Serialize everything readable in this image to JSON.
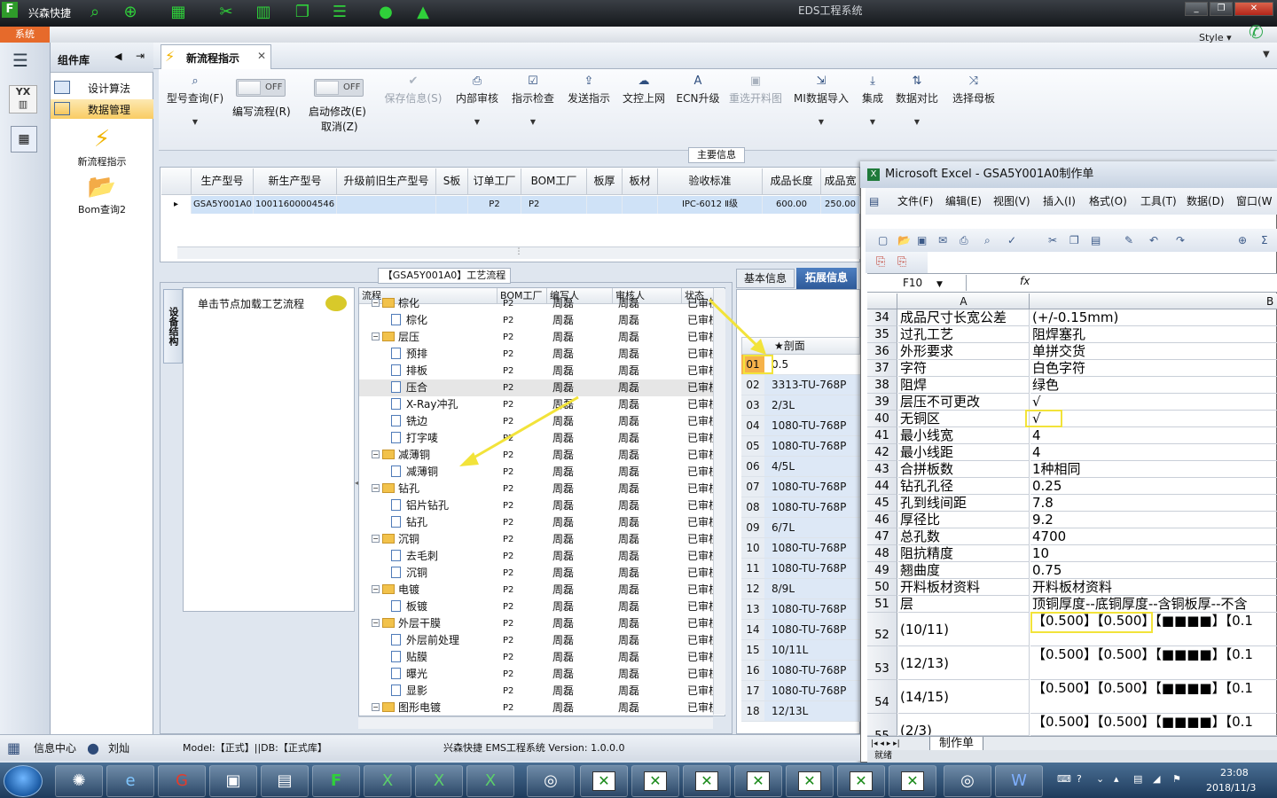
{
  "titlebar": {
    "app": "兴森快捷",
    "window_title": "EDS工程系统"
  },
  "topbar": {
    "system_tab": "系统",
    "style_menu": "Style"
  },
  "component_panel": {
    "title": "组件库",
    "items": [
      {
        "label": "设计算法"
      },
      {
        "label": "数据管理"
      }
    ],
    "big_items": [
      {
        "label": "新流程指示"
      },
      {
        "label": "Bom查询2"
      }
    ]
  },
  "doc_tab": {
    "label": "新流程指示"
  },
  "ribbon": {
    "model_query": "型号查询(F)",
    "toggle_off": "OFF",
    "edit_flow": "编写流程(R)",
    "enable_modify": "启动修改(E)",
    "cancel": "取消(Z)",
    "buttons": [
      {
        "label": "保存信息(S)",
        "disabled": true
      },
      {
        "label": "内部审核",
        "disabled": false
      },
      {
        "label": "指示检查",
        "disabled": false
      },
      {
        "label": "发送指示",
        "disabled": false
      },
      {
        "label": "文控上网",
        "disabled": false
      },
      {
        "label": "ECN升级",
        "disabled": false
      },
      {
        "label": "重选开料图",
        "disabled": true
      },
      {
        "label": "MI数据导入",
        "disabled": false
      },
      {
        "label": "集成",
        "disabled": false
      },
      {
        "label": "数据对比",
        "disabled": false
      },
      {
        "label": "选择母板",
        "disabled": false
      }
    ]
  },
  "main_info": {
    "group_label": "主要信息",
    "columns": [
      "生产型号",
      "新生产型号",
      "升级前旧生产型号",
      "S板",
      "订单工厂",
      "BOM工厂",
      "板厚",
      "板材",
      "验收标准",
      "成品长度",
      "成品宽"
    ],
    "row": [
      "GSA5Y001A0",
      "10011600004546",
      "",
      "",
      "P2",
      "P2",
      "",
      "",
      "IPC-6012 Ⅱ级",
      "600.00",
      "250.00"
    ]
  },
  "process": {
    "title": "【GSA5Y001A0】工艺流程",
    "side_tab": "设备结构",
    "load_hint": "单击节点加载工艺流程",
    "columns": [
      "流程",
      "BOM工厂",
      "编写人",
      "审核人",
      "状态"
    ],
    "rows": [
      {
        "name": "棕化",
        "level": 0,
        "kind": "folder",
        "bom": "P2",
        "writer": "周磊",
        "reviewer": "周磊",
        "status": "已审核"
      },
      {
        "name": "棕化",
        "level": 1,
        "kind": "page",
        "bom": "P2",
        "writer": "周磊",
        "reviewer": "周磊",
        "status": "已审核"
      },
      {
        "name": "层压",
        "level": 0,
        "kind": "folder",
        "bom": "P2",
        "writer": "周磊",
        "reviewer": "周磊",
        "status": "已审核"
      },
      {
        "name": "预排",
        "level": 1,
        "kind": "page",
        "bom": "P2",
        "writer": "周磊",
        "reviewer": "周磊",
        "status": "已审核"
      },
      {
        "name": "排板",
        "level": 1,
        "kind": "page",
        "bom": "P2",
        "writer": "周磊",
        "reviewer": "周磊",
        "status": "已审核"
      },
      {
        "name": "压合",
        "level": 1,
        "kind": "page",
        "bom": "P2",
        "writer": "周磊",
        "reviewer": "周磊",
        "status": "已审核"
      },
      {
        "name": "X-Ray冲孔",
        "level": 1,
        "kind": "page",
        "bom": "P2",
        "writer": "周磊",
        "reviewer": "周磊",
        "status": "已审核"
      },
      {
        "name": "铣边",
        "level": 1,
        "kind": "page",
        "bom": "P2",
        "writer": "周磊",
        "reviewer": "周磊",
        "status": "已审核"
      },
      {
        "name": "打字唛",
        "level": 1,
        "kind": "page",
        "bom": "P2",
        "writer": "周磊",
        "reviewer": "周磊",
        "status": "已审核"
      },
      {
        "name": "减薄铜",
        "level": 0,
        "kind": "folder",
        "bom": "P2",
        "writer": "周磊",
        "reviewer": "周磊",
        "status": "已审核"
      },
      {
        "name": "减薄铜",
        "level": 1,
        "kind": "page",
        "bom": "P2",
        "writer": "周磊",
        "reviewer": "周磊",
        "status": "已审核"
      },
      {
        "name": "钻孔",
        "level": 0,
        "kind": "folder",
        "bom": "P2",
        "writer": "周磊",
        "reviewer": "周磊",
        "status": "已审核"
      },
      {
        "name": "铝片钻孔",
        "level": 1,
        "kind": "page",
        "bom": "P2",
        "writer": "周磊",
        "reviewer": "周磊",
        "status": "已审核"
      },
      {
        "name": "钻孔",
        "level": 1,
        "kind": "page",
        "bom": "P2",
        "writer": "周磊",
        "reviewer": "周磊",
        "status": "已审核"
      },
      {
        "name": "沉铜",
        "level": 0,
        "kind": "folder",
        "bom": "P2",
        "writer": "周磊",
        "reviewer": "周磊",
        "status": "已审核"
      },
      {
        "name": "去毛刺",
        "level": 1,
        "kind": "page",
        "bom": "P2",
        "writer": "周磊",
        "reviewer": "周磊",
        "status": "已审核"
      },
      {
        "name": "沉铜",
        "level": 1,
        "kind": "page",
        "bom": "P2",
        "writer": "周磊",
        "reviewer": "周磊",
        "status": "已审核"
      },
      {
        "name": "电镀",
        "level": 0,
        "kind": "folder",
        "bom": "P2",
        "writer": "周磊",
        "reviewer": "周磊",
        "status": "已审核"
      },
      {
        "name": "板镀",
        "level": 1,
        "kind": "page",
        "bom": "P2",
        "writer": "周磊",
        "reviewer": "周磊",
        "status": "已审核"
      },
      {
        "name": "外层干膜",
        "level": 0,
        "kind": "folder",
        "bom": "P2",
        "writer": "周磊",
        "reviewer": "周磊",
        "status": "已审核"
      },
      {
        "name": "外层前处理",
        "level": 1,
        "kind": "page",
        "bom": "P2",
        "writer": "周磊",
        "reviewer": "周磊",
        "status": "已审核"
      },
      {
        "name": "贴膜",
        "level": 1,
        "kind": "page",
        "bom": "P2",
        "writer": "周磊",
        "reviewer": "周磊",
        "status": "已审核"
      },
      {
        "name": "曝光",
        "level": 1,
        "kind": "page",
        "bom": "P2",
        "writer": "周磊",
        "reviewer": "周磊",
        "status": "已审核"
      },
      {
        "name": "显影",
        "level": 1,
        "kind": "page",
        "bom": "P2",
        "writer": "周磊",
        "reviewer": "周磊",
        "status": "已审核"
      },
      {
        "name": "图形电镀",
        "level": 0,
        "kind": "folder",
        "bom": "P2",
        "writer": "周磊",
        "reviewer": "周磊",
        "status": "已审核"
      }
    ]
  },
  "side_panel": {
    "tabs": [
      "基本信息",
      "拓展信息"
    ],
    "col_header": "★剖面",
    "rows": [
      [
        "01",
        "0.5"
      ],
      [
        "02",
        "3313-TU-768P"
      ],
      [
        "03",
        "2/3L"
      ],
      [
        "04",
        "1080-TU-768P"
      ],
      [
        "05",
        "1080-TU-768P"
      ],
      [
        "06",
        "4/5L"
      ],
      [
        "07",
        "1080-TU-768P"
      ],
      [
        "08",
        "1080-TU-768P"
      ],
      [
        "09",
        "6/7L"
      ],
      [
        "10",
        "1080-TU-768P"
      ],
      [
        "11",
        "1080-TU-768P"
      ],
      [
        "12",
        "8/9L"
      ],
      [
        "13",
        "1080-TU-768P"
      ],
      [
        "14",
        "1080-TU-768P"
      ],
      [
        "15",
        "10/11L"
      ],
      [
        "16",
        "1080-TU-768P"
      ],
      [
        "17",
        "1080-TU-768P"
      ],
      [
        "18",
        "12/13L"
      ]
    ]
  },
  "excel": {
    "title": "Microsoft Excel - GSA5Y001A0制作单",
    "menu": [
      "文件(F)",
      "编辑(E)",
      "视图(V)",
      "插入(I)",
      "格式(O)",
      "工具(T)",
      "数据(D)",
      "窗口(W"
    ],
    "namebox": "F10",
    "fx": "fx",
    "col_a": "A",
    "col_b": "B",
    "rows": [
      {
        "n": "34",
        "a": "成品尺寸长宽公差",
        "b": "(+/-0.15mm)"
      },
      {
        "n": "35",
        "a": "过孔工艺",
        "b": "阻焊塞孔"
      },
      {
        "n": "36",
        "a": "外形要求",
        "b": "单拼交货"
      },
      {
        "n": "37",
        "a": "字符",
        "b": "白色字符"
      },
      {
        "n": "38",
        "a": "阻焊",
        "b": "绿色"
      },
      {
        "n": "39",
        "a": "层压不可更改",
        "b": "√"
      },
      {
        "n": "40",
        "a": "无铜区",
        "b": "√"
      },
      {
        "n": "41",
        "a": "最小线宽",
        "b": "4"
      },
      {
        "n": "42",
        "a": "最小线距",
        "b": "4"
      },
      {
        "n": "43",
        "a": "合拼板数",
        "b": "1种相同"
      },
      {
        "n": "44",
        "a": "钻孔孔径",
        "b": "0.25"
      },
      {
        "n": "45",
        "a": "孔到线间距",
        "b": "7.8"
      },
      {
        "n": "46",
        "a": "厚径比",
        "b": "9.2"
      },
      {
        "n": "47",
        "a": "总孔数",
        "b": "4700"
      },
      {
        "n": "48",
        "a": "阻抗精度",
        "b": "10"
      },
      {
        "n": "49",
        "a": "翘曲度",
        "b": "0.75"
      },
      {
        "n": "50",
        "a": "开料板材资料",
        "b": "开料板材资料"
      },
      {
        "n": "51",
        "a": "层",
        "b": "顶铜厚度--底铜厚度--含铜板厚--不含"
      },
      {
        "n": "52",
        "a": "(10/11)",
        "b": "【0.500】【0.500】【■■■■】【0.1"
      },
      {
        "n": "53",
        "a": "(12/13)",
        "b": "【0.500】【0.500】【■■■■】【0.1"
      },
      {
        "n": "54",
        "a": "(14/15)",
        "b": "【0.500】【0.500】【■■■■】【0.1"
      },
      {
        "n": "55",
        "a": "(2/3)",
        "b": "【0.500】【0.500】【■■■■】【0.1"
      }
    ],
    "sheet_tab": "制作单",
    "status": "就绪"
  },
  "statusbar": {
    "center": "信息中心",
    "user": "刘灿",
    "model": "Model:【正式】||DB:【正式库】",
    "version": "兴森快捷 EMS工程系统 Version: 1.0.0.0"
  },
  "taskbar": {
    "time": "23:08",
    "date": "2018/11/3"
  }
}
